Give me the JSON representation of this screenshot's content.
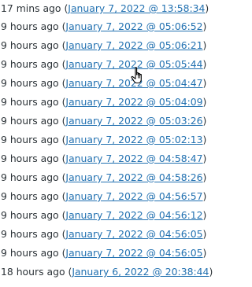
{
  "revisions": [
    {
      "ago": "17 mins ago",
      "date": "January 7, 2022 @ 13:58:34"
    },
    {
      "ago": "9 hours ago",
      "date": "January 7, 2022 @ 05:06:52"
    },
    {
      "ago": "9 hours ago",
      "date": "January 7, 2022 @ 05:06:21"
    },
    {
      "ago": "9 hours ago",
      "date": "January 7, 2022 @ 05:05:44"
    },
    {
      "ago": "9 hours ago",
      "date": "January 7, 2022 @ 05:04:47"
    },
    {
      "ago": "9 hours ago",
      "date": "January 7, 2022 @ 05:04:09"
    },
    {
      "ago": "9 hours ago",
      "date": "January 7, 2022 @ 05:03:26"
    },
    {
      "ago": "9 hours ago",
      "date": "January 7, 2022 @ 05:02:13"
    },
    {
      "ago": "9 hours ago",
      "date": "January 7, 2022 @ 04:58:47"
    },
    {
      "ago": "9 hours ago",
      "date": "January 7, 2022 @ 04:58:26"
    },
    {
      "ago": "9 hours ago",
      "date": "January 7, 2022 @ 04:56:57"
    },
    {
      "ago": "9 hours ago",
      "date": "January 7, 2022 @ 04:56:12"
    },
    {
      "ago": "9 hours ago",
      "date": "January 7, 2022 @ 04:56:05"
    },
    {
      "ago": "9 hours ago",
      "date": "January 7, 2022 @ 04:56:05"
    },
    {
      "ago": "18 hours ago",
      "date": "January 6, 2022 @ 20:38:44"
    }
  ],
  "colors": {
    "text": "#2c3338",
    "link": "#2271b1"
  },
  "cursor_icon": "hand-pointer-icon"
}
